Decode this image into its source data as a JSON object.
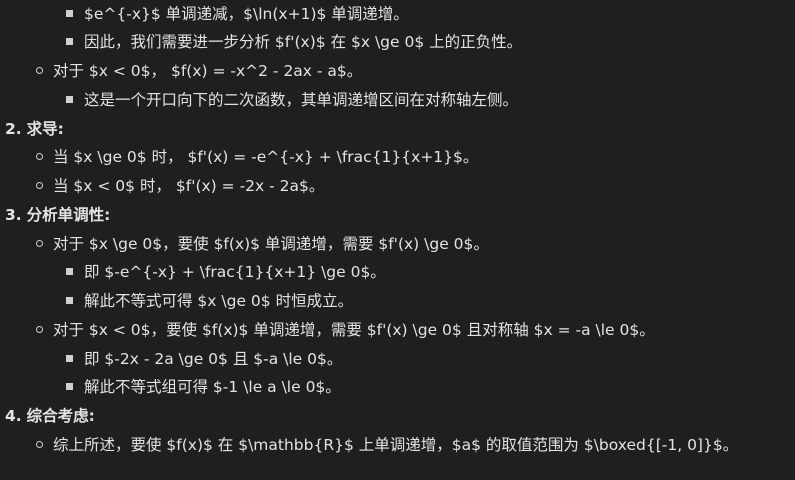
{
  "lines": [
    {
      "level": 3,
      "text": "$e^{-x}$ 单调递减，$\\ln(x+1)$ 单调递增。"
    },
    {
      "level": 3,
      "text": "因此，我们需要进一步分析 $f'(x)$ 在 $x \\ge 0$ 上的正负性。"
    },
    {
      "level": 2,
      "text": "对于 $x < 0$， $f(x) = -x^2 - 2ax - a$。"
    },
    {
      "level": 3,
      "text": "这是一个开口向下的二次函数，其单调递增区间在对称轴左侧。"
    },
    {
      "level": 1,
      "num": "2.",
      "text": "求导:"
    },
    {
      "level": 2,
      "text": "当 $x \\ge 0$ 时， $f'(x) = -e^{-x} + \\frac{1}{x+1}$。"
    },
    {
      "level": 2,
      "text": "当 $x < 0$ 时， $f'(x) = -2x - 2a$。"
    },
    {
      "level": 1,
      "num": "3.",
      "text": "分析单调性:"
    },
    {
      "level": 2,
      "text": "对于 $x \\ge 0$，要使 $f(x)$ 单调递增，需要 $f'(x) \\ge 0$。"
    },
    {
      "level": 3,
      "text": "即 $-e^{-x} + \\frac{1}{x+1} \\ge 0$。"
    },
    {
      "level": 3,
      "text": "解此不等式可得 $x \\ge 0$ 时恒成立。"
    },
    {
      "level": 2,
      "text": "对于 $x < 0$，要使 $f(x)$ 单调递增，需要 $f'(x) \\ge 0$ 且对称轴 $x = -a \\le 0$。"
    },
    {
      "level": 3,
      "text": "即 $-2x - 2a \\ge 0$ 且 $-a \\le 0$。"
    },
    {
      "level": 3,
      "text": "解此不等式组可得 $-1 \\le a \\le 0$。"
    },
    {
      "level": 1,
      "num": "4.",
      "text": "综合考虑:"
    },
    {
      "level": 2,
      "text": "综上所述，要使 $f(x)$ 在 $\\mathbb{R}$ 上单调递增，$a$ 的取值范围为 $\\boxed{[-1, 0]}$。"
    }
  ]
}
